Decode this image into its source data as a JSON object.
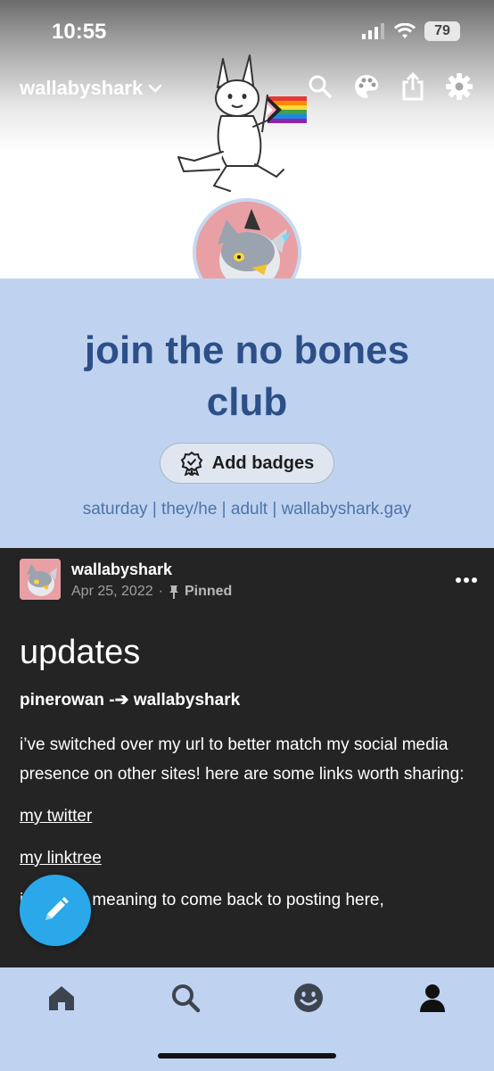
{
  "status_bar": {
    "time": "10:55",
    "battery": "79"
  },
  "header": {
    "blog_name": "wallabyshark",
    "icons": [
      "chevron-down-icon",
      "search-icon",
      "palette-icon",
      "share-icon",
      "gear-icon"
    ]
  },
  "profile": {
    "title": "join the no bones club",
    "badges_label": "Add badges",
    "description": "saturday | they/he | adult | wallabyshark.gay"
  },
  "post": {
    "author": "wallabyshark",
    "date": "Apr 25, 2022",
    "separator": "·",
    "pinned_label": "Pinned",
    "heading": "updates",
    "subheading": "pinerowan -➔ wallabyshark",
    "paragraph1": "i’ve switched over my url to better match my social media presence on other sites! here are some links worth sharing:",
    "link1": "my twitter",
    "link2": "my linktree",
    "paragraph2": "i’ve been meaning to come back to posting here,"
  },
  "nav": {
    "items": [
      "home-icon",
      "search-icon",
      "activity-icon",
      "account-icon"
    ]
  },
  "colors": {
    "accent": "#2aa8ea",
    "title": "#2d4f88",
    "background": "#bfd3f0",
    "post_bg": "#242424"
  }
}
